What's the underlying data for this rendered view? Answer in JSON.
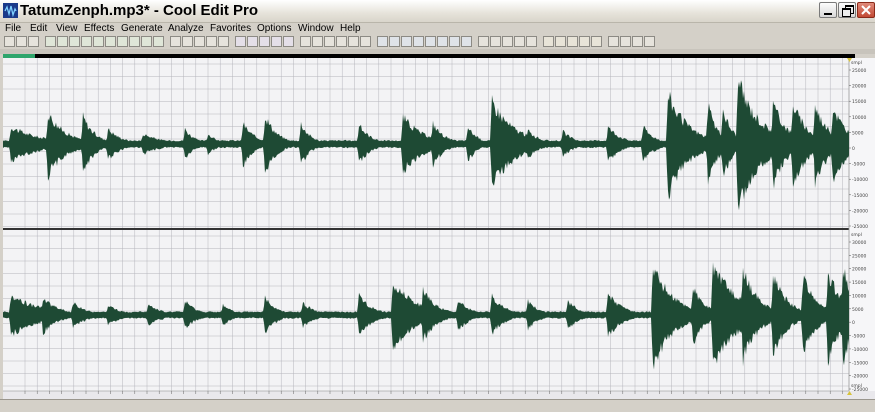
{
  "window": {
    "title": "TatumZenph.mp3* - Cool Edit Pro"
  },
  "menu": [
    "File",
    "Edit",
    "View",
    "Effects",
    "Generate",
    "Analyze",
    "Favorites",
    "Options",
    "Window",
    "Help"
  ],
  "colors": {
    "waveform": "#1e4a34",
    "background": "#f3f3f5",
    "grid": "#b5b5bc",
    "overview_selection": "#2ea56c"
  },
  "window_controls": [
    "minimize-icon",
    "restore-icon",
    "close-icon"
  ],
  "channels": [
    {
      "unit_label": "smpl",
      "ticks": [
        "25000",
        "20000",
        "15000",
        "10000",
        "5000",
        "0",
        "-5000",
        "-10000",
        "-15000",
        "-20000",
        "-25000"
      ]
    },
    {
      "unit_label": "smpl",
      "ticks": [
        "30000",
        "25000",
        "20000",
        "15000",
        "10000",
        "5000",
        "0",
        "-5000",
        "-10000",
        "-15000",
        "-20000",
        "-25000"
      ]
    }
  ],
  "time_ruler": {
    "unit_label": "smpl"
  }
}
